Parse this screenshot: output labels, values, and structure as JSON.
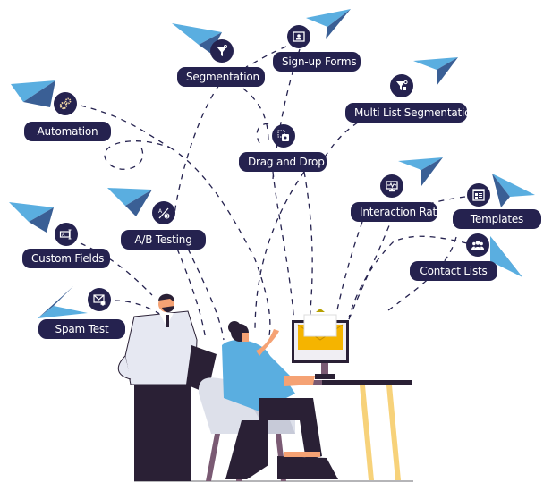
{
  "illustration": {
    "topic": "email marketing features",
    "features": [
      {
        "id": "segmentation",
        "label": "Segmentation",
        "icon": "funnel-icon"
      },
      {
        "id": "signup-forms",
        "label": "Sign-up Forms",
        "icon": "signup-form-icon"
      },
      {
        "id": "multi-list-segmentation",
        "label": "Multi List Segmentation",
        "icon": "funnel-person-icon"
      },
      {
        "id": "automation",
        "label": "Automation",
        "icon": "gears-icon"
      },
      {
        "id": "drag-and-drop",
        "label": "Drag and Drop",
        "icon": "drag-drop-icon"
      },
      {
        "id": "interaction-rate",
        "label": "Interaction Rate",
        "icon": "monitor-pulse-icon"
      },
      {
        "id": "templates",
        "label": "Templates",
        "icon": "template-layout-icon"
      },
      {
        "id": "ab-testing",
        "label": "A/B Testing",
        "icon": "ab-test-icon"
      },
      {
        "id": "custom-fields",
        "label": "Custom Fields",
        "icon": "text-field-icon"
      },
      {
        "id": "contact-lists",
        "label": "Contact Lists",
        "icon": "people-group-icon"
      },
      {
        "id": "spam-test",
        "label": "Spam Test",
        "icon": "envelope-bug-icon"
      }
    ],
    "colors": {
      "pill_bg": "#25224f",
      "pill_text": "#ffffff",
      "plane_light": "#5aaee0",
      "plane_dark": "#3a5f95",
      "envelope": "#f5b400",
      "shirt_blue": "#5aaee0",
      "dark": "#2a2035",
      "chair": "#dde0ea",
      "desk_leg": "#f7d27a",
      "skin": "#f5a274"
    }
  }
}
